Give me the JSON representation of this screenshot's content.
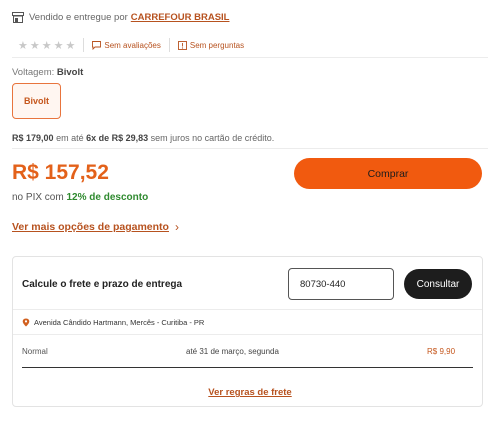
{
  "seller": {
    "prefix": "Vendido e entregue por",
    "name": "CARREFOUR BRASIL"
  },
  "rating": {
    "stars_filled": 0,
    "stars_total": 5,
    "reviews_label": "Sem avaliações",
    "questions_label": "Sem perguntas"
  },
  "voltage": {
    "label": "Voltagem:",
    "selected": "Bivolt",
    "options": [
      "Bivolt"
    ]
  },
  "installments": {
    "full_price": "R$ 179,00",
    "mid1": "em até",
    "plan": "6x de R$ 29,83",
    "suffix": "sem juros no cartão de crédito."
  },
  "price": {
    "value": "R$ 157,52",
    "pix_prefix": "no PIX com",
    "pix_discount": "12% de desconto"
  },
  "buy_button": "Comprar",
  "more_payment_link": "Ver mais opções de pagamento",
  "shipping": {
    "title": "Calcule o frete e prazo de entrega",
    "cep_value": "80730-440",
    "consult_button": "Consultar",
    "address": "Avenida Cândido Hartmann, Mercês - Curitiba - PR",
    "options": [
      {
        "type": "Normal",
        "date": "até 31 de março, segunda",
        "price": "R$ 9,90"
      }
    ],
    "rules_link": "Ver regras de frete"
  },
  "colors": {
    "accent": "#f15a0f",
    "link": "#b7521f",
    "discount_green": "#2f8a2f"
  }
}
